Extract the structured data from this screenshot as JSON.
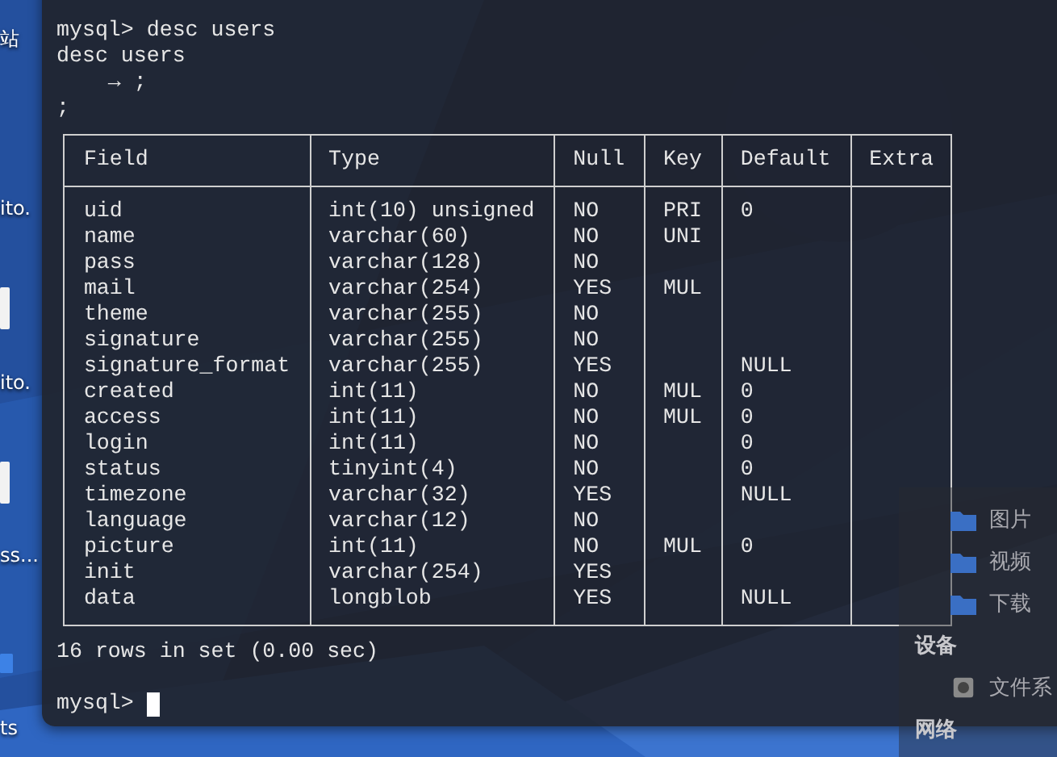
{
  "desktop": {
    "icon_labels": [
      {
        "label": "站"
      },
      {
        "label": "ito."
      },
      {
        "label": "ito."
      },
      {
        "label": "ss..."
      },
      {
        "label": "ts"
      }
    ]
  },
  "file_panel": {
    "items": [
      {
        "kind": "place",
        "label": "图片"
      },
      {
        "kind": "place",
        "label": "视频"
      },
      {
        "kind": "place",
        "label": "下载"
      },
      {
        "kind": "heading",
        "label": "设备"
      },
      {
        "kind": "device",
        "label": "文件系"
      },
      {
        "kind": "heading",
        "label": "网络"
      }
    ]
  },
  "terminal": {
    "lines": [
      "mysql> desc users",
      "desc users",
      "    → ;",
      ";"
    ],
    "table": {
      "columns": [
        "Field",
        "Type",
        "Null",
        "Key",
        "Default",
        "Extra"
      ],
      "rows": [
        {
          "field": "uid",
          "type": "int(10) unsigned",
          "null": "NO",
          "key": "PRI",
          "default": "0"
        },
        {
          "field": "name",
          "type": "varchar(60)",
          "null": "NO",
          "key": "UNI"
        },
        {
          "field": "pass",
          "type": "varchar(128)",
          "null": "NO"
        },
        {
          "field": "mail",
          "type": "varchar(254)",
          "null": "YES",
          "key": "MUL"
        },
        {
          "field": "theme",
          "type": "varchar(255)",
          "null": "NO"
        },
        {
          "field": "signature",
          "type": "varchar(255)",
          "null": "NO"
        },
        {
          "field": "signature_format",
          "type": "varchar(255)",
          "null": "YES",
          "default": "NULL"
        },
        {
          "field": "created",
          "type": "int(11)",
          "null": "NO",
          "key": "MUL",
          "default": "0"
        },
        {
          "field": "access",
          "type": "int(11)",
          "null": "NO",
          "key": "MUL",
          "default": "0"
        },
        {
          "field": "login",
          "type": "int(11)",
          "null": "NO",
          "default": "0"
        },
        {
          "field": "status",
          "type": "tinyint(4)",
          "null": "NO",
          "default": "0"
        },
        {
          "field": "timezone",
          "type": "varchar(32)",
          "null": "YES",
          "default": "NULL"
        },
        {
          "field": "language",
          "type": "varchar(12)",
          "null": "NO"
        },
        {
          "field": "picture",
          "type": "int(11)",
          "null": "NO",
          "key": "MUL",
          "default": "0"
        },
        {
          "field": "init",
          "type": "varchar(254)",
          "null": "YES"
        },
        {
          "field": "data",
          "type": "longblob",
          "null": "YES",
          "default": "NULL"
        }
      ]
    },
    "summary": "16 rows in set (0.00 sec)",
    "prompt": "mysql>",
    "cursor_visible": true
  }
}
